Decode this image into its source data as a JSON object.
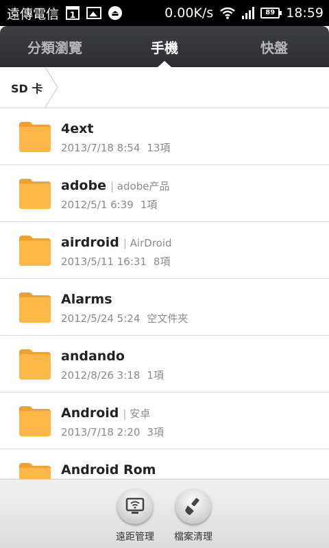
{
  "status_bar": {
    "carrier": "遠傳電信",
    "calendar_day": "1",
    "net_speed": "0.00K/s",
    "battery": "89",
    "time": "18:59"
  },
  "tabs": [
    {
      "label": "分類瀏覽",
      "active": false
    },
    {
      "label": "手機",
      "active": true
    },
    {
      "label": "快盤",
      "active": false
    }
  ],
  "breadcrumb": {
    "path": "SD 卡"
  },
  "files": [
    {
      "name": "4ext",
      "desc": "",
      "date": "2013/7/18 8:54",
      "info": "13項"
    },
    {
      "name": "adobe",
      "desc": "adobe产品",
      "date": "2012/5/1 6:39",
      "info": "1項"
    },
    {
      "name": "airdroid",
      "desc": "AirDroid",
      "date": "2013/5/11 16:31",
      "info": "8項"
    },
    {
      "name": "Alarms",
      "desc": "",
      "date": "2012/5/24 5:24",
      "info": "空文件夾"
    },
    {
      "name": "andando",
      "desc": "",
      "date": "2012/8/26 3:18",
      "info": "1項"
    },
    {
      "name": "Android",
      "desc": "安卓",
      "date": "2013/7/18 2:20",
      "info": "3項"
    },
    {
      "name": "Android Rom",
      "desc": "",
      "date": "",
      "info": ""
    }
  ],
  "bottom_bar": {
    "remote_label": "遠距管理",
    "cleanup_label": "檔案清理"
  },
  "colors": {
    "folder": "#f9b13b",
    "tab_bar": "#333437",
    "accent_text": "#222222",
    "meta_text": "#8a8a8a"
  },
  "icons": {
    "status": [
      "calendar-icon",
      "image-icon",
      "upload-icon",
      "wifi-icon",
      "signal-icon",
      "battery-icon"
    ],
    "list": "folder-icon",
    "bottom": [
      "remote-monitor-icon",
      "broom-icon"
    ]
  }
}
